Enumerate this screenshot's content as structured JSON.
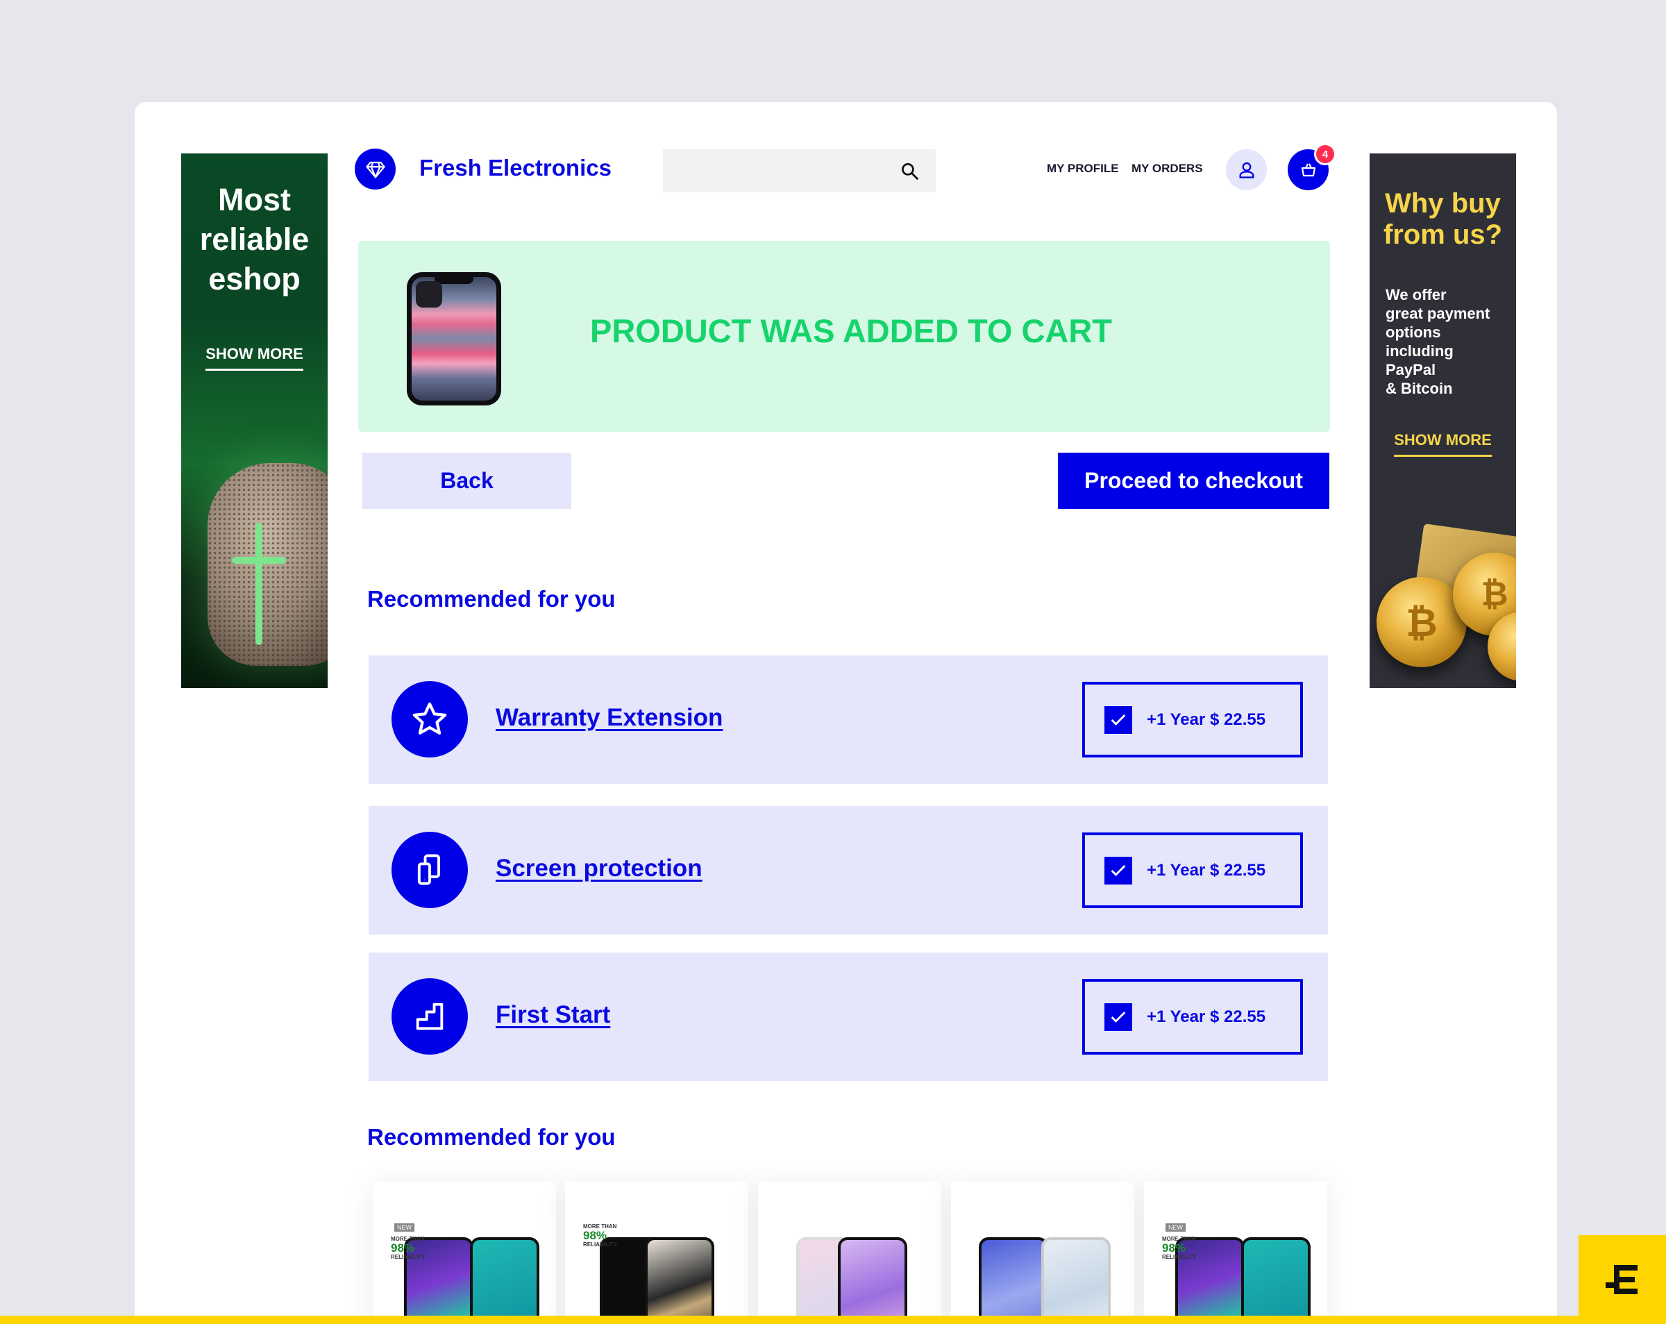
{
  "header": {
    "brand": "Fresh Electronics",
    "search_placeholder": "",
    "nav": [
      "MY PROFILE",
      "MY ORDERS"
    ],
    "cart_count": "4",
    "brand_color": "#0000e6"
  },
  "ad_left": {
    "title": "Most reliable eshop",
    "cta": "SHOW MORE"
  },
  "ad_right": {
    "title": "Why buy from us?",
    "copy": "We offer\ngreat payment\noptions\nincluding\nPayPal\n& Bitcoin",
    "cta": "SHOW MORE"
  },
  "banner": {
    "message": "PRODUCT WAS ADDED TO CART",
    "color": "#16d36b"
  },
  "actions": {
    "back": "Back",
    "checkout": "Proceed to checkout"
  },
  "services_section": {
    "title": "Recommended for you",
    "items": [
      {
        "name": "Warranty Extension",
        "icon": "star-icon",
        "option": "+1 Year $ 22.55",
        "checked": true
      },
      {
        "name": "Screen protection",
        "icon": "devices-icon",
        "option": "+1 Year $ 22.55",
        "checked": true
      },
      {
        "name": "First Start",
        "icon": "stairs-icon",
        "option": "+1 Year $ 22.55",
        "checked": true
      }
    ]
  },
  "products_section": {
    "title": "Recommended for you",
    "badges": {
      "new": "NEW",
      "more_than": "MORE THAN",
      "percent": "98%",
      "reliability": "RELIABILITY"
    }
  }
}
